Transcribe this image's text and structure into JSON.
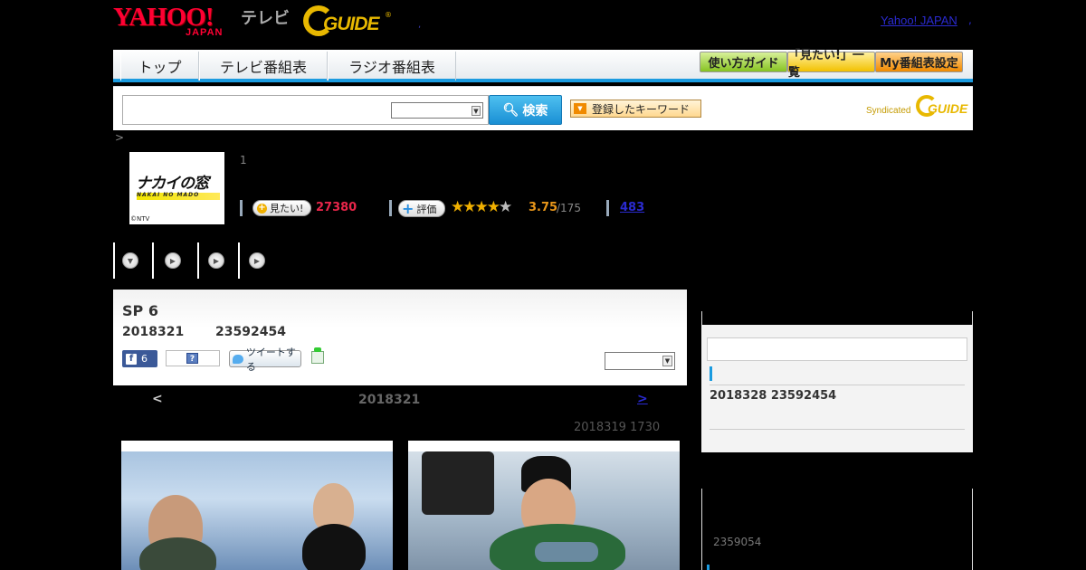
{
  "header": {
    "yahoo_logo": "YAHOO!",
    "yahoo_sub": "JAPAN",
    "tv_label": "テレビ",
    "gguide_logo": "GUIDE",
    "gguide_reg": "®",
    "separator_dot": ",",
    "yahoo_japan_link": "Yahoo! JAPAN",
    "trailing": ","
  },
  "nav": {
    "tabs": [
      "トップ",
      "テレビ番組表",
      "ラジオ番組表"
    ],
    "buttons": {
      "guide": "使い方ガイド",
      "mitai_list": "「見たい!」一覧",
      "my_schedule": "My番組表設定"
    }
  },
  "search": {
    "input_value": "",
    "select_value": "",
    "button_label": "検索",
    "keyword_button": "登録したキーワード",
    "syndicated": "Syndicated",
    "syndicated_logo": "GUIDE"
  },
  "breadcrumb": ">",
  "program": {
    "thumb_title": "ナカイの窓",
    "thumb_romaji": "NAKAI NO MADO",
    "thumb_copyright": "©NTV",
    "number": "1",
    "mitai_label": "見たい!",
    "mitai_count": "27380",
    "hyoka_label": "評価",
    "stars": "★★★★★",
    "rating_value": 3.75,
    "rating": "3.75",
    "rating_total": "/175",
    "review_count": "483"
  },
  "episode": {
    "title": "SP 6",
    "date": "2018321",
    "id": "23592454",
    "fb_count": "6",
    "hatena_icon": "?",
    "tweet_label": "ツイートする",
    "select_value": ""
  },
  "pager": {
    "prev": "<",
    "current": "2018321",
    "next": ">"
  },
  "air_info": "2018319  1730",
  "sidebar": {
    "next_broadcast": "2018328  23592454",
    "lower_id": "2359054"
  },
  "colors": {
    "accent_blue": "#1a9be0",
    "mitai_red": "#e8264a",
    "rating_orange": "#e8961a",
    "yahoo_red": "#ff0033",
    "gguide_yellow": "#e8b800"
  }
}
